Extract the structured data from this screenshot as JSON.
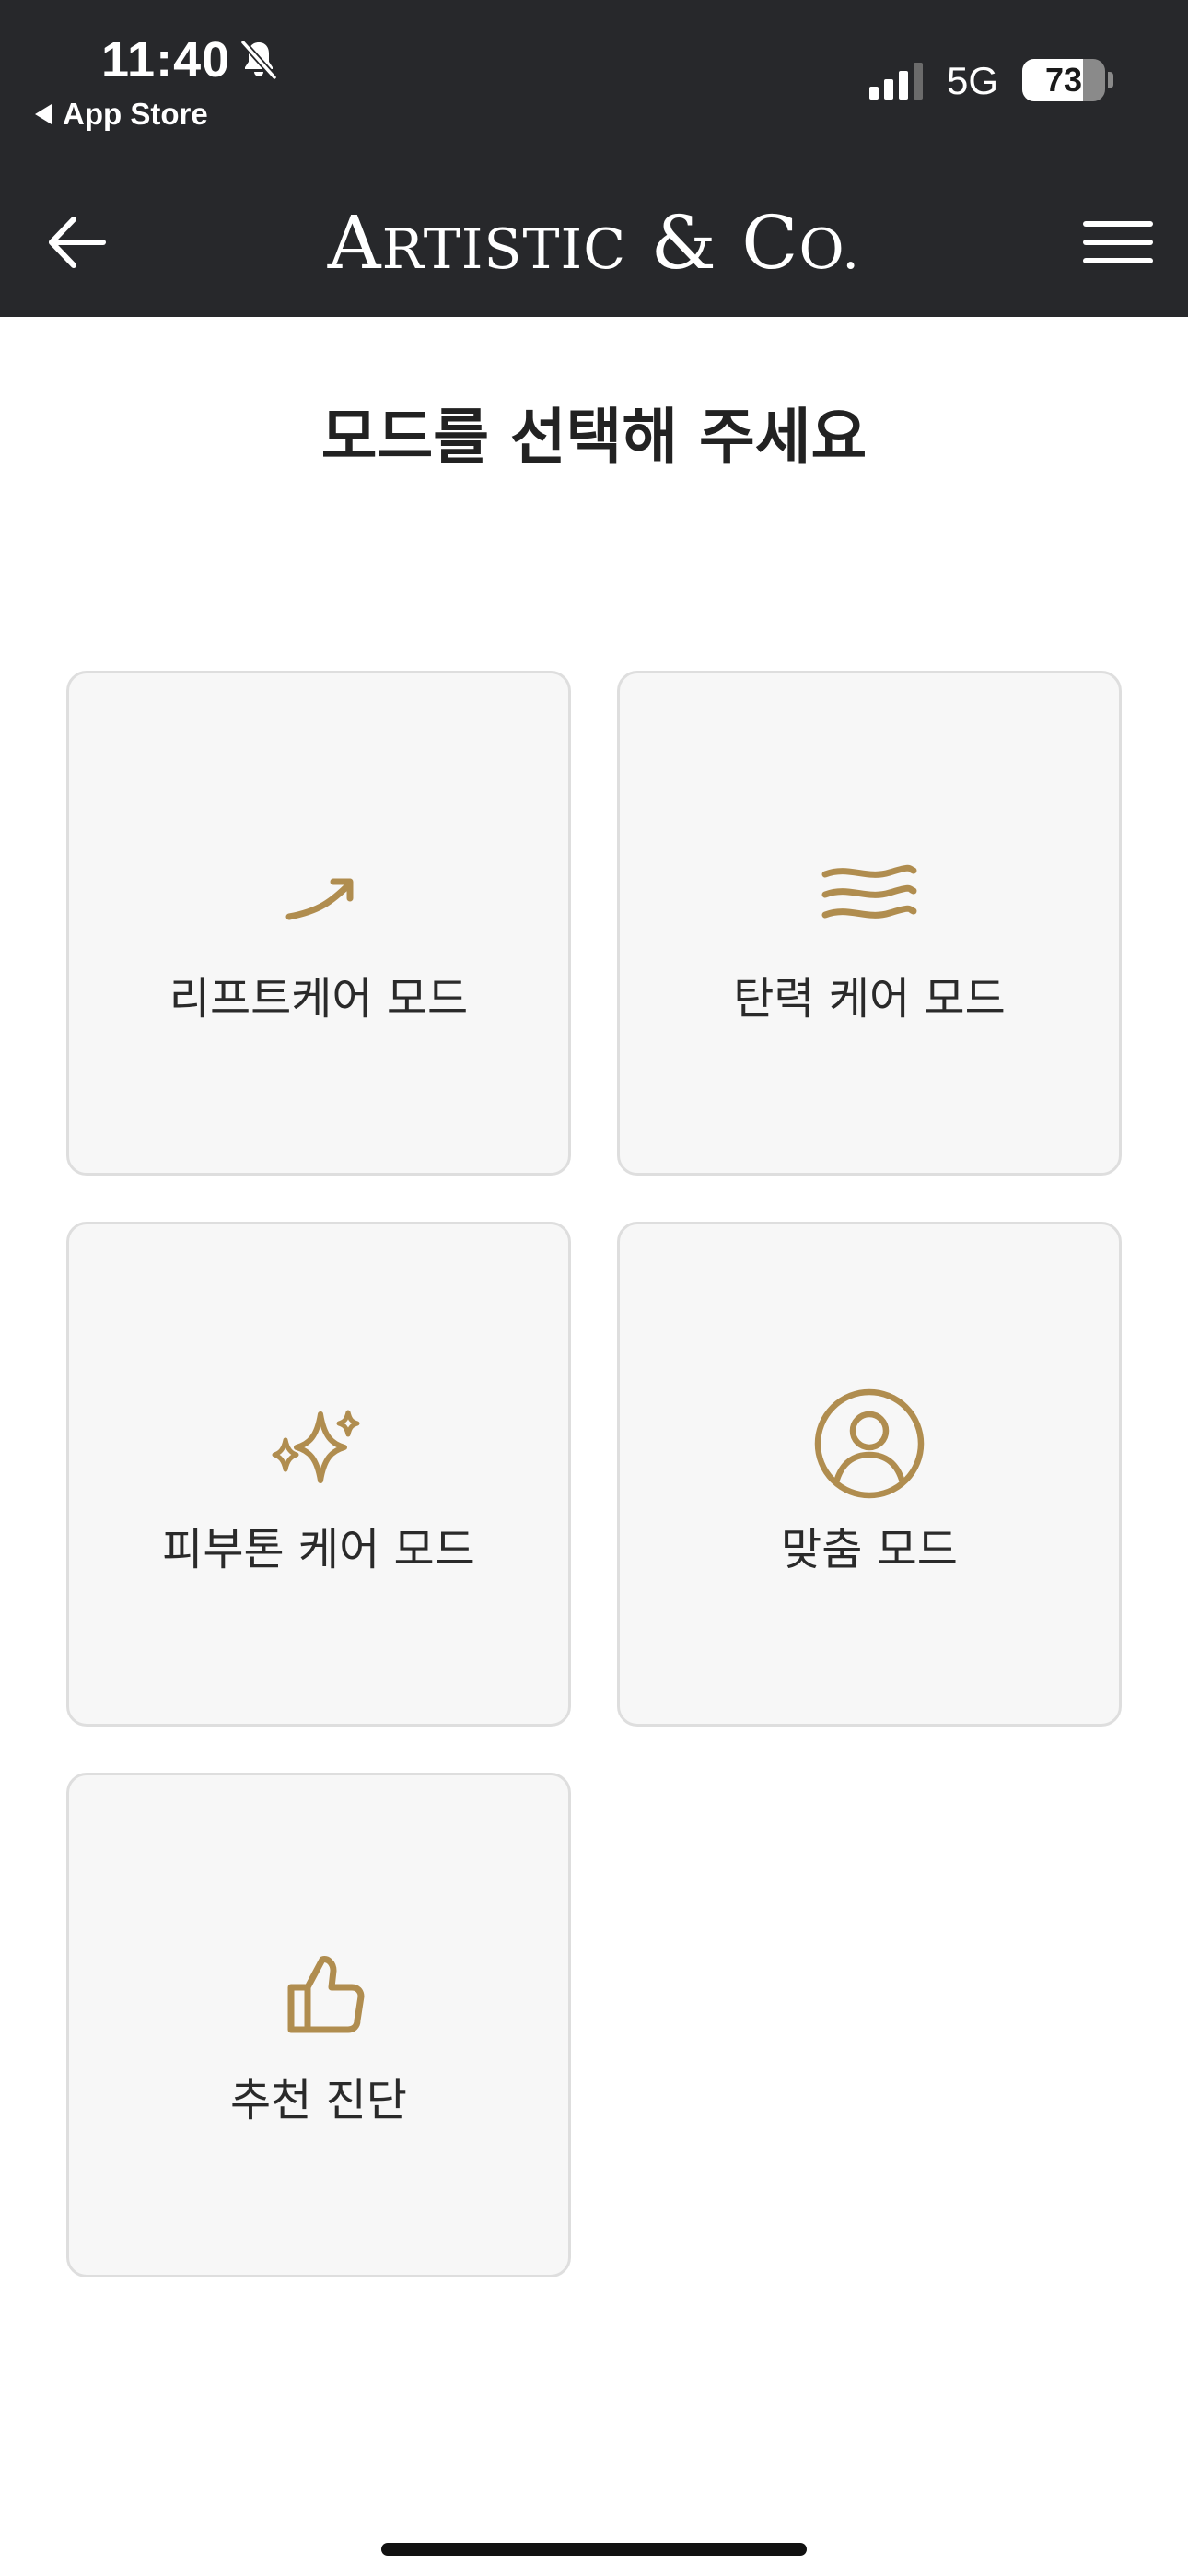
{
  "status_bar": {
    "time": "11:40",
    "back_app_label": "App Store",
    "network": "5G",
    "battery_percent": 73
  },
  "header": {
    "brand": "ARTISTIC & CO.",
    "brand_parts": [
      "A",
      "RTISTIC",
      " & ",
      "C",
      "O."
    ]
  },
  "main": {
    "title": "모드를 선택해 주세요",
    "modes": [
      {
        "label": "리프트케어 모드",
        "icon": "rising-arrow-icon"
      },
      {
        "label": "탄력 케어 모드",
        "icon": "wave-lines-icon"
      },
      {
        "label": "피부톤 케어 모드",
        "icon": "sparkle-icon"
      },
      {
        "label": "맞춤 모드",
        "icon": "user-circle-icon"
      },
      {
        "label": "추천 진단",
        "icon": "thumbs-up-icon"
      }
    ]
  },
  "colors": {
    "header_bg": "#27282b",
    "accent_gold": "#b08d4f",
    "card_bg": "#f7f7f7",
    "card_border": "#dedede",
    "text_dark": "#222222"
  }
}
